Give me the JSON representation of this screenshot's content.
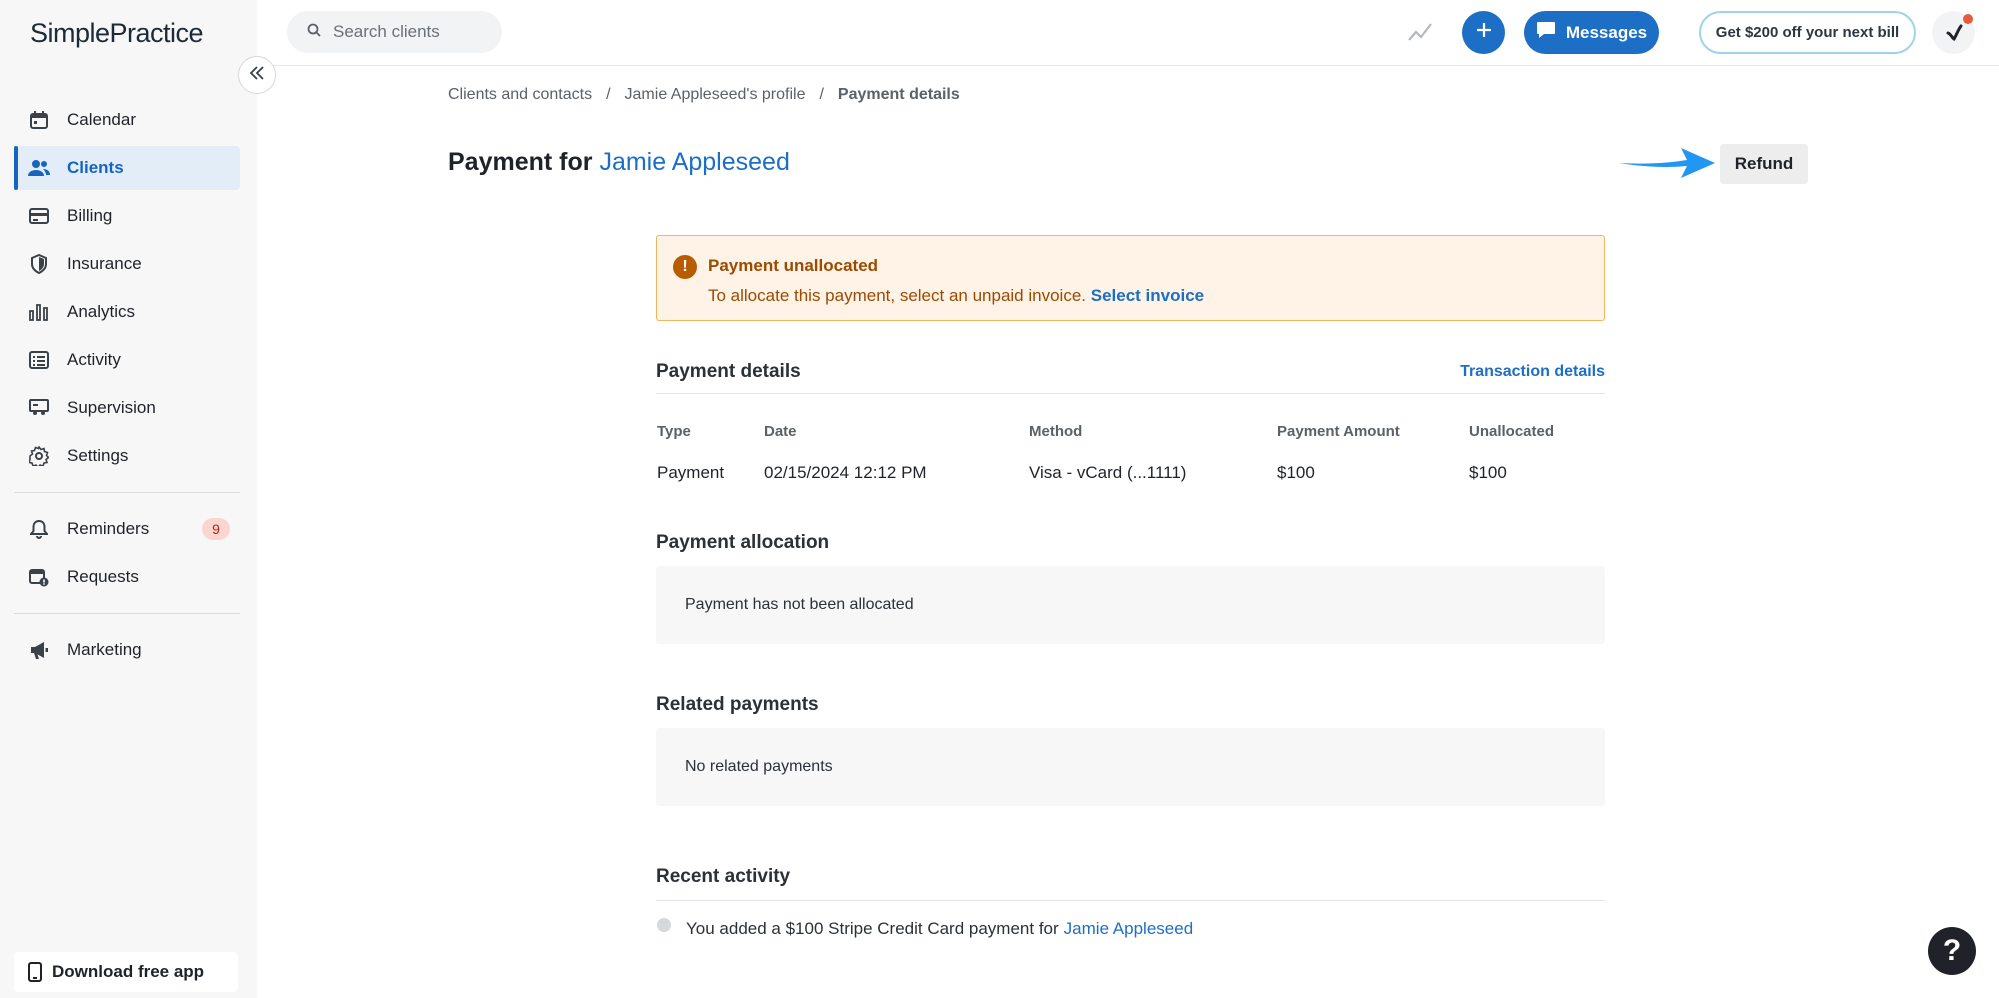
{
  "app": {
    "logo": "SimplePractice"
  },
  "sidebar": {
    "nav": [
      {
        "label": "Calendar",
        "icon": "calendar-icon"
      },
      {
        "label": "Clients",
        "icon": "clients-icon",
        "active": true
      },
      {
        "label": "Billing",
        "icon": "billing-icon"
      },
      {
        "label": "Insurance",
        "icon": "shield-icon"
      },
      {
        "label": "Analytics",
        "icon": "analytics-icon"
      },
      {
        "label": "Activity",
        "icon": "activity-icon"
      },
      {
        "label": "Supervision",
        "icon": "supervision-icon"
      },
      {
        "label": "Settings",
        "icon": "gear-icon"
      }
    ],
    "secondary": [
      {
        "label": "Reminders",
        "icon": "bell-icon",
        "badge": "9"
      },
      {
        "label": "Requests",
        "icon": "requests-icon"
      }
    ],
    "tertiary": [
      {
        "label": "Marketing",
        "icon": "megaphone-icon"
      }
    ],
    "download_label": "Download free app"
  },
  "topbar": {
    "search_placeholder": "Search clients",
    "messages_label": "Messages",
    "promo_label": "Get $200 off your next bill"
  },
  "breadcrumb": {
    "items": [
      "Clients and contacts",
      "Jamie Appleseed's profile"
    ],
    "current": "Payment details",
    "separator": "/"
  },
  "page": {
    "title_prefix": "Payment for",
    "client_name": "Jamie Appleseed",
    "refund_label": "Refund"
  },
  "alert": {
    "title": "Payment unallocated",
    "body": "To allocate this payment, select an unpaid invoice.",
    "link": "Select invoice"
  },
  "payment_details": {
    "title": "Payment details",
    "link": "Transaction details",
    "headers": [
      "Type",
      "Date",
      "Method",
      "Payment Amount",
      "Unallocated"
    ],
    "row": [
      "Payment",
      "02/15/2024 12:12 PM",
      "Visa - vCard (...1111)",
      "$100",
      "$100"
    ]
  },
  "allocation": {
    "title": "Payment allocation",
    "empty": "Payment has not been allocated"
  },
  "related": {
    "title": "Related payments",
    "empty": "No related payments"
  },
  "recent": {
    "title": "Recent activity",
    "entry_text": "You added a $100 Stripe Credit Card payment for",
    "entry_link": "Jamie Appleseed"
  },
  "help": {
    "label": "?"
  },
  "colors": {
    "accent": "#1d6fc5",
    "alert_bg": "#fef3e6",
    "alert_border": "#f0b761",
    "arrow": "#2196f3"
  }
}
